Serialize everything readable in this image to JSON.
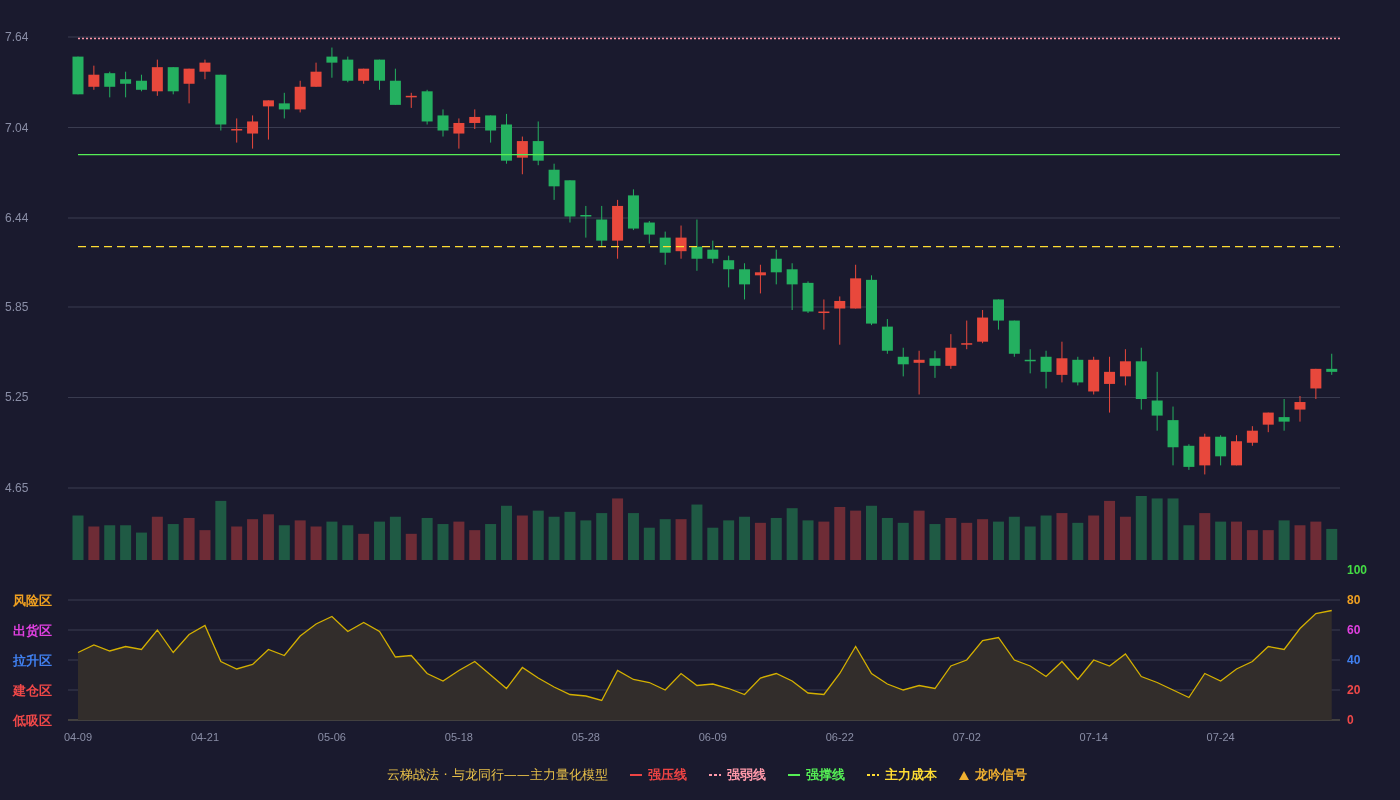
{
  "price_chart": {
    "chart_data": {
      "type": "candlestick",
      "grid": true,
      "ylim": [
        4.65,
        7.64
      ],
      "yticks": [
        4.65,
        5.25,
        5.85,
        6.44,
        7.04,
        7.64
      ],
      "ohlc": [
        [
          7.51,
          7.51,
          7.26,
          7.26
        ],
        [
          7.31,
          7.45,
          7.29,
          7.39
        ],
        [
          7.4,
          7.41,
          7.24,
          7.31
        ],
        [
          7.36,
          7.41,
          7.24,
          7.33
        ],
        [
          7.35,
          7.39,
          7.28,
          7.29
        ],
        [
          7.28,
          7.49,
          7.25,
          7.44
        ],
        [
          7.44,
          7.44,
          7.26,
          7.28
        ],
        [
          7.33,
          7.43,
          7.2,
          7.43
        ],
        [
          7.41,
          7.49,
          7.36,
          7.47
        ],
        [
          7.39,
          7.39,
          7.02,
          7.06
        ],
        [
          7.02,
          7.1,
          6.94,
          7.03
        ],
        [
          7.0,
          7.12,
          6.9,
          7.08
        ],
        [
          7.18,
          7.22,
          6.96,
          7.22
        ],
        [
          7.2,
          7.27,
          7.1,
          7.16
        ],
        [
          7.16,
          7.35,
          7.14,
          7.31
        ],
        [
          7.31,
          7.47,
          7.31,
          7.41
        ],
        [
          7.51,
          7.57,
          7.37,
          7.47
        ],
        [
          7.49,
          7.51,
          7.34,
          7.35
        ],
        [
          7.35,
          7.43,
          7.33,
          7.43
        ],
        [
          7.49,
          7.49,
          7.29,
          7.35
        ],
        [
          7.35,
          7.43,
          7.19,
          7.19
        ],
        [
          7.24,
          7.27,
          7.17,
          7.25
        ],
        [
          7.28,
          7.29,
          7.06,
          7.08
        ],
        [
          7.12,
          7.16,
          6.98,
          7.02
        ],
        [
          7.0,
          7.1,
          6.9,
          7.07
        ],
        [
          7.07,
          7.16,
          7.03,
          7.11
        ],
        [
          7.12,
          7.12,
          6.94,
          7.02
        ],
        [
          7.06,
          7.13,
          6.8,
          6.82
        ],
        [
          6.84,
          6.98,
          6.73,
          6.95
        ],
        [
          6.95,
          7.08,
          6.79,
          6.82
        ],
        [
          6.76,
          6.8,
          6.56,
          6.65
        ],
        [
          6.69,
          6.69,
          6.41,
          6.45
        ],
        [
          6.46,
          6.52,
          6.31,
          6.45
        ],
        [
          6.43,
          6.52,
          6.25,
          6.29
        ],
        [
          6.29,
          6.56,
          6.17,
          6.52
        ],
        [
          6.59,
          6.63,
          6.36,
          6.37
        ],
        [
          6.41,
          6.42,
          6.27,
          6.33
        ],
        [
          6.31,
          6.35,
          6.13,
          6.21
        ],
        [
          6.22,
          6.39,
          6.17,
          6.31
        ],
        [
          6.25,
          6.43,
          6.09,
          6.17
        ],
        [
          6.23,
          6.29,
          6.14,
          6.17
        ],
        [
          6.16,
          6.19,
          5.98,
          6.1
        ],
        [
          6.1,
          6.14,
          5.9,
          6.0
        ],
        [
          6.06,
          6.13,
          5.94,
          6.08
        ],
        [
          6.17,
          6.23,
          6.0,
          6.08
        ],
        [
          6.1,
          6.14,
          5.83,
          6.0
        ],
        [
          6.01,
          6.02,
          5.81,
          5.82
        ],
        [
          5.81,
          5.9,
          5.7,
          5.82
        ],
        [
          5.84,
          5.92,
          5.6,
          5.89
        ],
        [
          5.84,
          6.13,
          5.84,
          6.04
        ],
        [
          6.03,
          6.06,
          5.73,
          5.74
        ],
        [
          5.72,
          5.77,
          5.54,
          5.56
        ],
        [
          5.52,
          5.58,
          5.39,
          5.47
        ],
        [
          5.48,
          5.56,
          5.27,
          5.5
        ],
        [
          5.51,
          5.56,
          5.38,
          5.46
        ],
        [
          5.46,
          5.67,
          5.44,
          5.58
        ],
        [
          5.6,
          5.76,
          5.57,
          5.61
        ],
        [
          5.62,
          5.83,
          5.61,
          5.78
        ],
        [
          5.9,
          5.9,
          5.7,
          5.76
        ],
        [
          5.76,
          5.76,
          5.52,
          5.54
        ],
        [
          5.5,
          5.57,
          5.41,
          5.49
        ],
        [
          5.52,
          5.56,
          5.31,
          5.42
        ],
        [
          5.4,
          5.62,
          5.35,
          5.51
        ],
        [
          5.5,
          5.52,
          5.33,
          5.35
        ],
        [
          5.29,
          5.52,
          5.27,
          5.5
        ],
        [
          5.34,
          5.52,
          5.15,
          5.42
        ],
        [
          5.39,
          5.57,
          5.33,
          5.49
        ],
        [
          5.49,
          5.58,
          5.17,
          5.24
        ],
        [
          5.23,
          5.42,
          5.03,
          5.13
        ],
        [
          5.1,
          5.19,
          4.8,
          4.92
        ],
        [
          4.93,
          4.94,
          4.77,
          4.79
        ],
        [
          4.8,
          5.01,
          4.74,
          4.99
        ],
        [
          4.99,
          5.0,
          4.8,
          4.86
        ],
        [
          4.8,
          5.0,
          4.8,
          4.96
        ],
        [
          4.95,
          5.06,
          4.93,
          5.03
        ],
        [
          5.07,
          5.15,
          5.02,
          5.15
        ],
        [
          5.12,
          5.24,
          5.03,
          5.09
        ],
        [
          5.17,
          5.26,
          5.09,
          5.22
        ],
        [
          5.31,
          5.44,
          5.24,
          5.44
        ],
        [
          5.44,
          5.54,
          5.4,
          5.42
        ]
      ],
      "ref_lines": [
        {
          "axis": "y",
          "value": 7.63,
          "color": "#ff99aa"
        },
        {
          "axis": "y",
          "value": 6.86,
          "color": "#55ee55"
        },
        {
          "axis": "y",
          "value": 6.25,
          "color": "#ffdd33"
        }
      ]
    }
  },
  "indicator_chart": {
    "zones": [
      {
        "label": "风险区",
        "color": "#f0a020"
      },
      {
        "label": "出货区",
        "color": "#e040e0"
      },
      {
        "label": "拉升区",
        "color": "#4080f0"
      },
      {
        "label": "建仓区",
        "color": "#f04848"
      },
      {
        "label": "低吸区",
        "color": "#f04848"
      }
    ],
    "tick_marks": [
      {
        "color": "#44dd44"
      },
      {
        "color": "#f0a020"
      },
      {
        "color": "#e040e0"
      },
      {
        "color": "#4080f0"
      },
      {
        "color": "#f04848"
      },
      {
        "color": "#f04848"
      }
    ],
    "chart_data": {
      "type": "area",
      "grid": true,
      "ylim": [
        0,
        100
      ],
      "yticks": [
        100,
        80,
        60,
        40,
        20,
        0
      ],
      "categories": [
        "04-09",
        null,
        null,
        null,
        null,
        null,
        null,
        null,
        "04-21",
        null,
        null,
        null,
        null,
        null,
        null,
        null,
        "05-06",
        null,
        null,
        null,
        null,
        null,
        null,
        null,
        "05-18",
        null,
        null,
        null,
        null,
        null,
        null,
        null,
        "05-28",
        null,
        null,
        null,
        null,
        null,
        null,
        null,
        "06-09",
        null,
        null,
        null,
        null,
        null,
        null,
        null,
        "06-22",
        null,
        null,
        null,
        null,
        null,
        null,
        null,
        "07-02",
        null,
        null,
        null,
        null,
        null,
        null,
        null,
        "07-14",
        null,
        null,
        null,
        null,
        null,
        null,
        null,
        "07-24",
        null,
        null,
        null,
        null,
        null,
        null,
        null
      ],
      "series": [
        {
          "color": "#d4b000",
          "values": [
            45,
            50,
            46,
            49,
            47,
            60,
            45,
            57,
            63,
            39,
            34,
            37,
            47,
            43,
            56,
            64,
            69,
            59,
            65,
            59,
            42,
            43,
            31,
            26,
            33,
            39,
            30,
            21,
            35,
            28,
            22,
            17,
            16,
            13,
            33,
            27,
            25,
            20,
            31,
            23,
            24,
            21,
            17,
            28,
            31,
            26,
            18,
            17,
            31,
            49,
            31,
            24,
            20,
            23,
            21,
            36,
            40,
            53,
            55,
            40,
            36,
            29,
            39,
            27,
            40,
            36,
            44,
            29,
            25,
            20,
            15,
            31,
            26,
            34,
            39,
            49,
            47,
            61,
            71,
            73
          ]
        }
      ]
    }
  },
  "legend": {
    "title": "云梯战法 · 与龙同行——主力量化模型",
    "items": [
      {
        "label": "强压线",
        "kind": "solid",
        "color": "#ee4444"
      },
      {
        "label": "强弱线",
        "kind": "dashed",
        "color": "#ff99aa"
      },
      {
        "label": "强撑线",
        "kind": "solid",
        "color": "#55ee55"
      },
      {
        "label": "主力成本",
        "kind": "dashed",
        "color": "#ffdd33"
      },
      {
        "label": "龙吟信号",
        "kind": "triangle",
        "color": "#f0b030"
      }
    ]
  }
}
